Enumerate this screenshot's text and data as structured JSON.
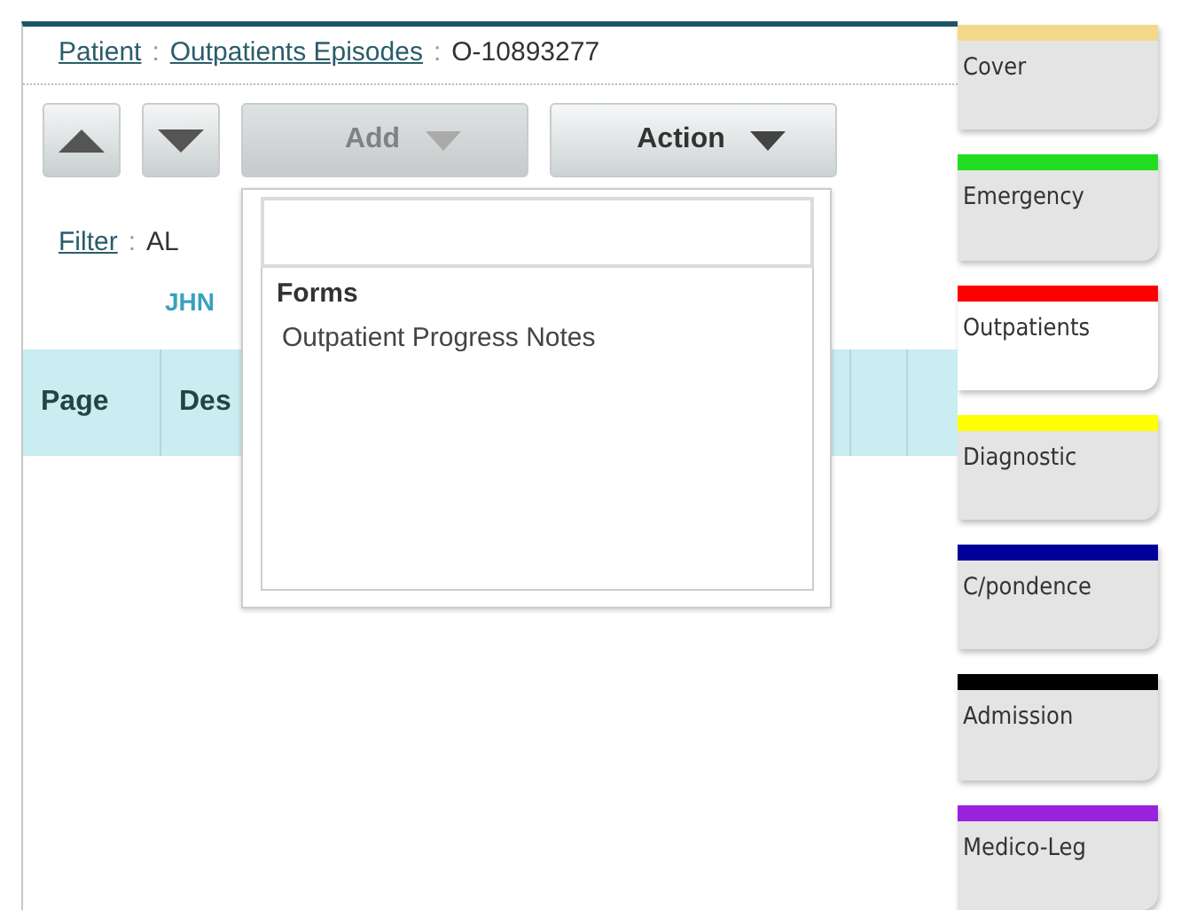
{
  "breadcrumb": [
    {
      "label": "Patient",
      "link": true
    },
    {
      "separator": ":",
      "label": "Outpatients Episodes",
      "link": true
    },
    {
      "separator": ":",
      "label": "O-10893277",
      "link": false
    }
  ],
  "toolbar": {
    "nav_buttons": [
      {
        "kind": "up"
      },
      {
        "kind": "down"
      }
    ],
    "menus": [
      {
        "label": "Add",
        "disabled": true
      },
      {
        "label": "Action",
        "disabled": false
      }
    ]
  },
  "filter": {
    "label": "Filter",
    "separator": ":",
    "value": "AL",
    "subvalue": "JHN"
  },
  "table": {
    "columns": [
      "Page",
      "Des"
    ]
  },
  "dropdown": {
    "groups": [
      {
        "heading": "Forms",
        "items": [
          "Outpatient Progress Notes"
        ]
      }
    ]
  },
  "tabs": [
    {
      "label": "Cover",
      "color": "#f2d98a",
      "selected": false
    },
    {
      "label": "Emergency",
      "color": "#22dd22",
      "selected": false
    },
    {
      "label": "Outpatients",
      "color": "#ff0000",
      "selected": true
    },
    {
      "label": "Diagnostic",
      "color": "#ffff00",
      "selected": false
    },
    {
      "label": "C/pondence",
      "color": "#000099",
      "selected": false
    },
    {
      "label": "Admission",
      "color": "#000000",
      "selected": false
    },
    {
      "label": "Medico-Leg",
      "color": "#9922dd",
      "selected": false
    }
  ]
}
